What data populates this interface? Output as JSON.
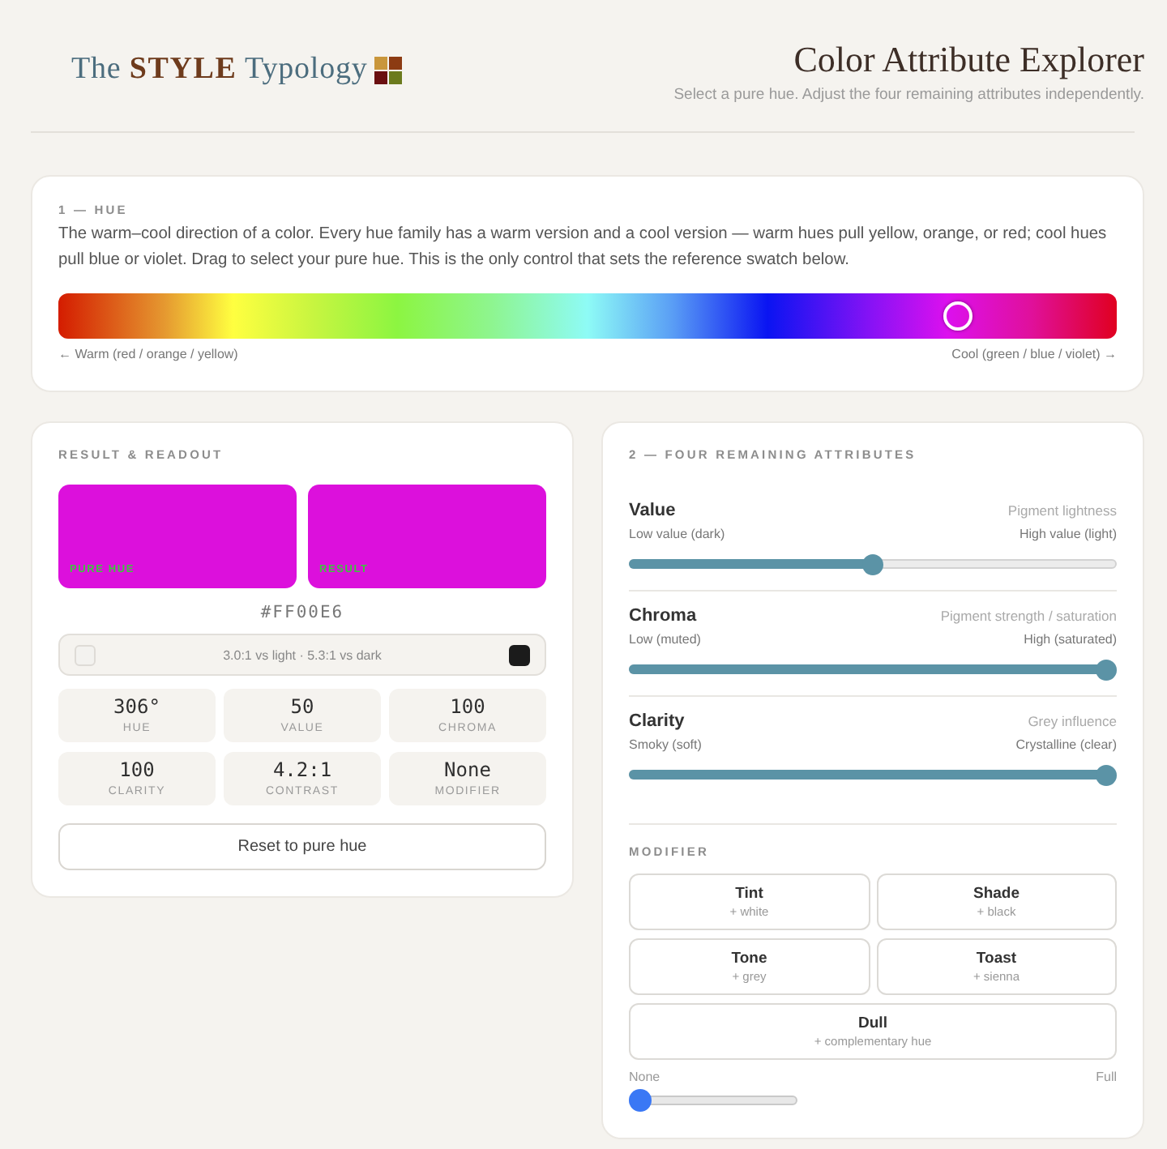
{
  "header": {
    "logo": "The **STYLE** Typology",
    "title": "Color Attribute Explorer",
    "subtitle": "Select a pure hue. Adjust the four remaining attributes independently."
  },
  "hue_panel": {
    "heading": "1 — HUE",
    "description": "The warm–cool direction of a color. Every hue family has a warm version and a cool version — warm hues pull yellow, orange, or red; cool hues pull blue or violet. Drag to select your pure hue. This is the only control that sets the reference swatch below.",
    "level": 0.85,
    "low_label": "← Warm (red / orange / yellow)",
    "high_label": "Cool (green / blue / violet) →"
  },
  "result_panel": {
    "heading": "RESULT & READOUT",
    "swatches": [
      {
        "label": "PURE HUE",
        "color": "#dc10dc"
      },
      {
        "label": "RESULT",
        "color": "#dc10dc"
      }
    ],
    "hex": "#FF00E6",
    "contrast": "3.0:1 vs light · 5.3:1 vs dark",
    "stats": [
      {
        "value": "306°",
        "label": "HUE"
      },
      {
        "value": "50",
        "label": "VALUE"
      },
      {
        "value": "100",
        "label": "CHROMA"
      },
      {
        "value": "100",
        "label": "CLARITY"
      },
      {
        "value": "4.2:1",
        "label": "CONTRAST"
      },
      {
        "value": "None",
        "label": "MODIFIER"
      }
    ],
    "reset_button": "Reset to pure hue"
  },
  "attributes_panel": {
    "heading": "2 — FOUR REMAINING ATTRIBUTES",
    "attributes": [
      {
        "name": "Value",
        "description": "Pigment lightness",
        "low_label": "Low value (dark)",
        "high_label": "High value (light)",
        "level": 0.5
      },
      {
        "name": "Chroma",
        "description": "Pigment strength / saturation",
        "low_label": "Low (muted)",
        "high_label": "High (saturated)",
        "level": 1
      },
      {
        "name": "Clarity",
        "description": "Grey influence",
        "low_label": "Smoky (soft)",
        "high_label": "Crystalline (clear)",
        "level": 1
      }
    ],
    "modifier": {
      "heading": "MODIFIER",
      "options": [
        {
          "name": "Tint",
          "detail": "+ white",
          "selected": false
        },
        {
          "name": "Shade",
          "detail": "+ black",
          "selected": false
        },
        {
          "name": "Tone",
          "detail": "+ grey",
          "selected": false
        },
        {
          "name": "Toast",
          "detail": "+ sienna",
          "selected": false
        },
        {
          "name": "Dull",
          "detail": "+ complementary hue",
          "selected": false
        }
      ],
      "low_label": "None",
      "high_label": "Full",
      "level": 0
    }
  }
}
